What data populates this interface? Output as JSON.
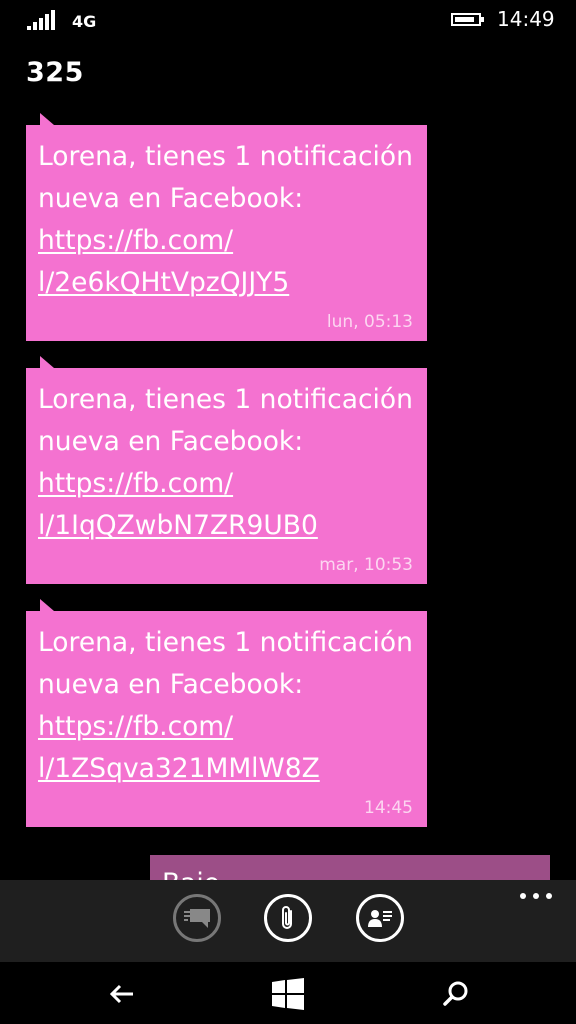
{
  "status": {
    "network": "4G",
    "time": "14:49",
    "signal_bars": 5,
    "battery_level": 0.85
  },
  "thread": {
    "title": "325"
  },
  "messages": [
    {
      "text": "Lorena, tienes 1 notificación nueva en Facebook: ",
      "link": "https://fb.com/l/2e6kQHtVpzQJJY5",
      "link_display": "https://fb.com/​l/2e6kQHtVpzQJJY5",
      "time": "lun, 05:13"
    },
    {
      "text": "Lorena, tienes 1 notificación nueva en Facebook: ",
      "link": "https://fb.com/l/1IqQZwbN7ZR9UB0",
      "link_display": "https://fb.com/​l/1IqQZwbN7ZR9UB0",
      "time": "mar, 10:53"
    },
    {
      "text": "Lorena, tienes 1 notificación nueva en Facebook: ",
      "link": "https://fb.com/l/1ZSqva321MMlW8Z",
      "link_display": "https://fb.com/​l/1ZSqva321MMlW8Z",
      "time": "14:45"
    }
  ],
  "outgoing_partial": {
    "text": "Bajo"
  },
  "colors": {
    "incoming_bubble": "#f472d0",
    "outgoing_bubble": "#9c4e87",
    "app_bar": "#1f1f1f",
    "background": "#000000"
  },
  "app_bar": {
    "buttons": [
      {
        "name": "smiley-chat-icon",
        "state": "disabled"
      },
      {
        "name": "attach-icon",
        "state": "enabled"
      },
      {
        "name": "contact-card-icon",
        "state": "enabled"
      }
    ]
  },
  "nav": {
    "back": "back-arrow-icon",
    "start": "windows-start-icon",
    "search": "search-icon"
  }
}
